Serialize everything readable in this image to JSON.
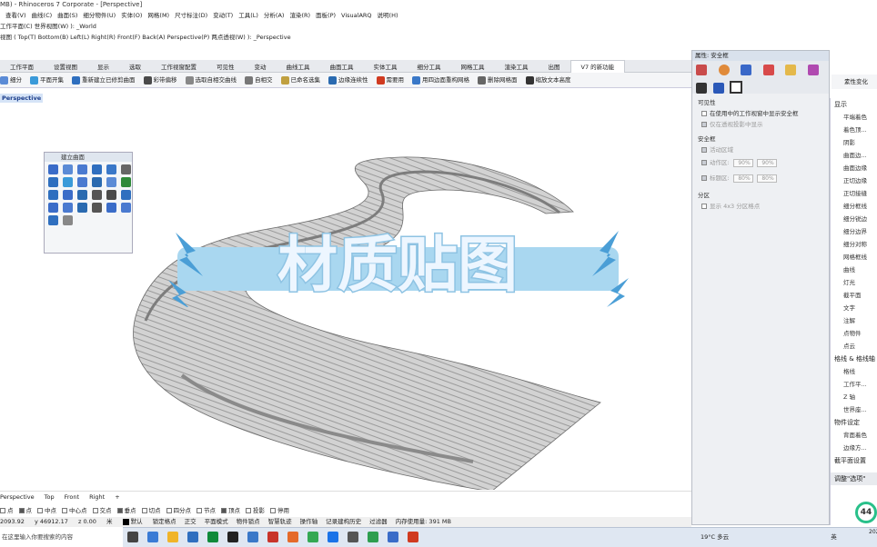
{
  "window": {
    "title": "MB) - Rhinoceros 7 Corporate - [Perspective]"
  },
  "menu": [
    "",
    "查看(V)",
    "曲线(C)",
    "曲面(S)",
    "细分物件(U)",
    "实体(O)",
    "网格(M)",
    "尺寸标注(D)",
    "变动(T)",
    "工具(L)",
    "分析(A)",
    "渲染(R)",
    "面板(P)",
    "VisualARQ",
    "说明(H)"
  ],
  "command_history": {
    "line1": "工作平面(C)  世界视图(W) ): _World",
    "line2": "视图 ( Top(T)  Bottom(B)  Left(L)  Right(R)  Front(F)  Back(A)  Perspective(P)  两点透视(W) ): _Perspective"
  },
  "ribbon_tabs": [
    "工作平面",
    "设置视图",
    "显示",
    "选取",
    "工作视窗配置",
    "可见性",
    "变动",
    "曲线工具",
    "曲面工具",
    "实体工具",
    "细分工具",
    "网格工具",
    "渲染工具",
    "出图",
    "V7 的新功能"
  ],
  "ribbon_active": "V7 的新功能",
  "toolbar": [
    {
      "label": "细分",
      "color": "#5b8bd6"
    },
    {
      "label": "平面开集",
      "color": "#3a9ad9"
    },
    {
      "label": "重新建立已修剪曲面",
      "color": "#2f6fbf"
    },
    {
      "label": "彩带偏移",
      "color": "#4a4a4a"
    },
    {
      "label": "选取自相交曲线",
      "color": "#888888"
    },
    {
      "label": "自相交",
      "color": "#777777"
    },
    {
      "label": "已命名选集",
      "color": "#c0a040"
    },
    {
      "label": "边缘连续性",
      "color": "#2a6ab0"
    },
    {
      "label": "需要用",
      "color": "#d03a20"
    },
    {
      "label": "用四边面重构网格",
      "color": "#3a78c8"
    },
    {
      "label": "删除网格面",
      "color": "#666666"
    },
    {
      "label": "缩放文本高度",
      "color": "#333333"
    }
  ],
  "viewport": {
    "label": "Perspective"
  },
  "float_panel": {
    "title": "建立曲面",
    "icon_colors": [
      "#3a6cc8",
      "#5b8bd6",
      "#4a7ad0",
      "#2f6fbf",
      "#3a78c8",
      "#666666",
      "#2f6fbf",
      "#3a9ad9",
      "#4a7ad0",
      "#2a6ab0",
      "#5b8bd6",
      "#2f8a3a",
      "#2f6fbf",
      "#3a6cc8",
      "#2a6ab0",
      "#555555",
      "#4a4a4a",
      "#2f6fbf",
      "#3a6cc8",
      "#4a7ad0",
      "#2a6ab0",
      "#555555",
      "#3a6cc8",
      "#4a7ad0",
      "#2f6fbf",
      "#888888"
    ]
  },
  "banner": {
    "text": "材质贴图"
  },
  "properties": {
    "title": "属性: 安全框",
    "visibility_label": "可见性",
    "show_in_viewport": "在使用中的工作视窗中显示安全框",
    "show_in_perspective": "仅在透视投影中显示",
    "safe_frame_label": "安全框",
    "live_area": "活动区域",
    "action_area": "动作区:",
    "action_w": "90%",
    "action_h": "90%",
    "title_area": "标题区:",
    "title_w": "80%",
    "title_h": "80%",
    "split_label": "分区",
    "split_option": "显示 4x3 分区格点"
  },
  "display_panel": {
    "material_button": "素性变化",
    "title": "显示",
    "items": [
      "平端着色",
      "着色顶...",
      "阴影",
      "曲面边...",
      "曲面边缘",
      "正切边缘",
      "正切接缝",
      "细分框线",
      "细分锐边",
      "细分边界",
      "细分对称",
      "网格框线",
      "曲线",
      "灯光",
      "截平面",
      "文字",
      "注解",
      "点物件",
      "点云"
    ],
    "section2": "格线 & 格线轴",
    "items2": [
      "格线",
      "工作平...",
      "Z 轴",
      "世界座..."
    ],
    "section3": "物件设定",
    "items3": [
      "背面着色",
      "边缘方..."
    ],
    "section4": "截平面设置",
    "bottom": "调整\"选项\""
  },
  "viewport_tabs": [
    "Perspective",
    "Top",
    "Front",
    "Right",
    "+"
  ],
  "osnaps": [
    {
      "label": "点",
      "on": false
    },
    {
      "label": "点",
      "on": true
    },
    {
      "label": "中点",
      "on": false
    },
    {
      "label": "中心点",
      "on": false
    },
    {
      "label": "交点",
      "on": false
    },
    {
      "label": "垂点",
      "on": true
    },
    {
      "label": "切点",
      "on": false
    },
    {
      "label": "四分点",
      "on": false
    },
    {
      "label": "节点",
      "on": false
    },
    {
      "label": "顶点",
      "on": true
    },
    {
      "label": "投影",
      "on": false
    },
    {
      "label": "停用",
      "on": false
    }
  ],
  "status": {
    "x": "2093.92",
    "y": "y 46912.17",
    "z": "z 0.00",
    "units": "米",
    "layer": "默认",
    "items": [
      "锁定格点",
      "正交",
      "平面模式",
      "物件锁点",
      "智慧轨迹",
      "操作轴",
      "记录建构历史",
      "过滤器",
      "内存使用量: 391 MB"
    ]
  },
  "taskbar": {
    "search": "在这里输入你要搜索的内容",
    "weather": "19°C 多云",
    "lang": "英",
    "time": "202",
    "zoom_badge": "44"
  },
  "colors": {
    "banner_text": "#e8f4ff",
    "banner_outline": "#9bcbe8",
    "banner_bolt": "#4a9ed6",
    "road": "#c4c4c4",
    "road_dark": "#8a8a8a"
  }
}
